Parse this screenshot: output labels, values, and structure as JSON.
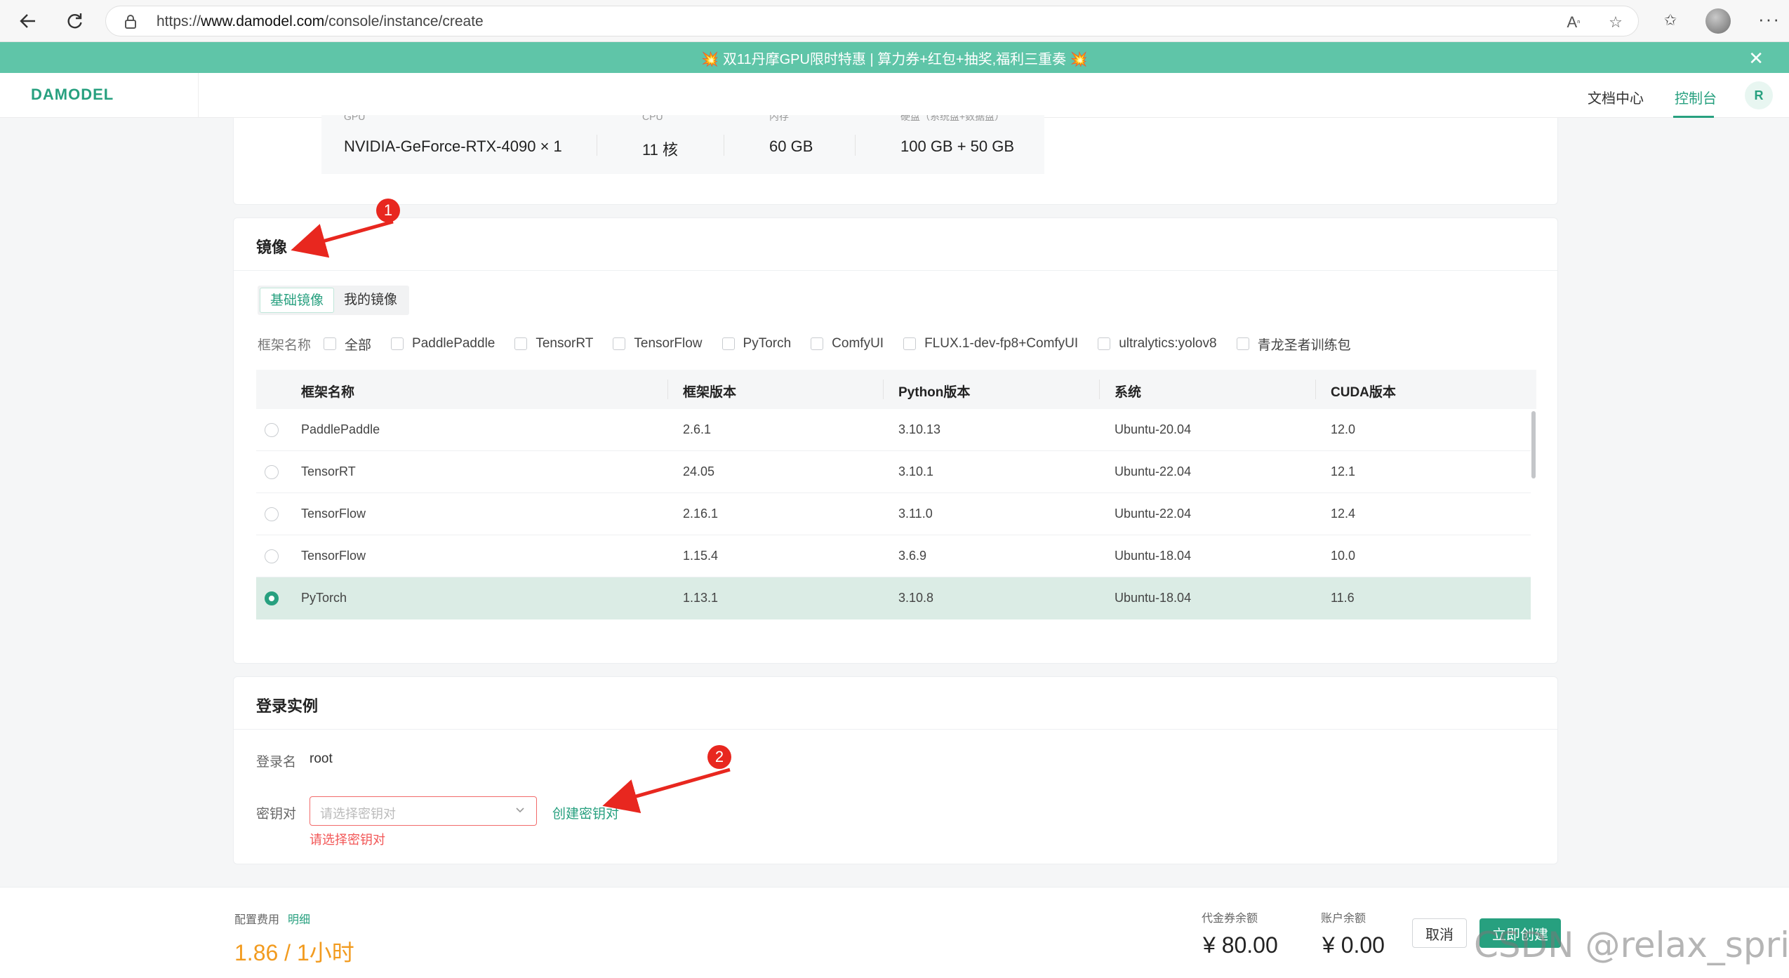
{
  "browser": {
    "url_prefix": "https://",
    "url_host": "www.damodel.com",
    "url_path": "/console/instance/create"
  },
  "promo": {
    "text": "💥 双11丹摩GPU限时特惠 | 算力券+红包+抽奖,福利三重奏 💥",
    "close_icon": "✕"
  },
  "header": {
    "logo": "DAMODEL",
    "docs": "文档中心",
    "console": "控制台",
    "avatar": "R"
  },
  "spec": {
    "labels": [
      "GPU",
      "CPU",
      "内存",
      "硬盘（系统盘+数据盘）"
    ],
    "gpu": "NVIDIA-GeForce-RTX-4090 × 1",
    "cpu": "11 核",
    "memory": "60 GB",
    "disk": "100 GB + 50 GB"
  },
  "image_section": {
    "title": "镜像",
    "tabs": [
      "基础镜像",
      "我的镜像"
    ],
    "filter_label": "框架名称",
    "filters": [
      "全部",
      "PaddlePaddle",
      "TensorRT",
      "TensorFlow",
      "PyTorch",
      "ComfyUI",
      "FLUX.1-dev-fp8+ComfyUI",
      "ultralytics:yolov8",
      "青龙圣者训练包"
    ],
    "columns": [
      "框架名称",
      "框架版本",
      "Python版本",
      "系统",
      "CUDA版本"
    ],
    "rows": [
      {
        "name": "PaddlePaddle",
        "version": "2.6.1",
        "python": "3.10.13",
        "os": "Ubuntu-20.04",
        "cuda": "12.0"
      },
      {
        "name": "TensorRT",
        "version": "24.05",
        "python": "3.10.1",
        "os": "Ubuntu-22.04",
        "cuda": "12.1"
      },
      {
        "name": "TensorFlow",
        "version": "2.16.1",
        "python": "3.11.0",
        "os": "Ubuntu-22.04",
        "cuda": "12.4"
      },
      {
        "name": "TensorFlow",
        "version": "1.15.4",
        "python": "3.6.9",
        "os": "Ubuntu-18.04",
        "cuda": "10.0"
      },
      {
        "name": "PyTorch",
        "version": "1.13.1",
        "python": "3.10.8",
        "os": "Ubuntu-18.04",
        "cuda": "11.6"
      }
    ],
    "selected_row": 4
  },
  "login_section": {
    "title": "登录实例",
    "login_label": "登录名",
    "login_value": "root",
    "key_label": "密钥对",
    "key_placeholder": "请选择密钥对",
    "key_error": "请选择密钥对",
    "create_key_link": "创建密钥对"
  },
  "footer": {
    "cost_label": "配置费用",
    "detail_link": "明细",
    "price": "1.86 / 1小时",
    "voucher_label": "代金券余额",
    "voucher_value": "¥ 80.00",
    "balance_label": "账户余额",
    "balance_value": "¥ 0.00",
    "cancel": "取消",
    "create": "立即创建"
  },
  "annotations": {
    "badge1": "1",
    "badge2": "2",
    "color": "#e8271f"
  },
  "watermark": "CSDN @relax_spring",
  "colors": {
    "brand": "#27a07f",
    "promo_bg": "#5fc5a8",
    "price": "#f29b1f",
    "error": "#f25656"
  }
}
